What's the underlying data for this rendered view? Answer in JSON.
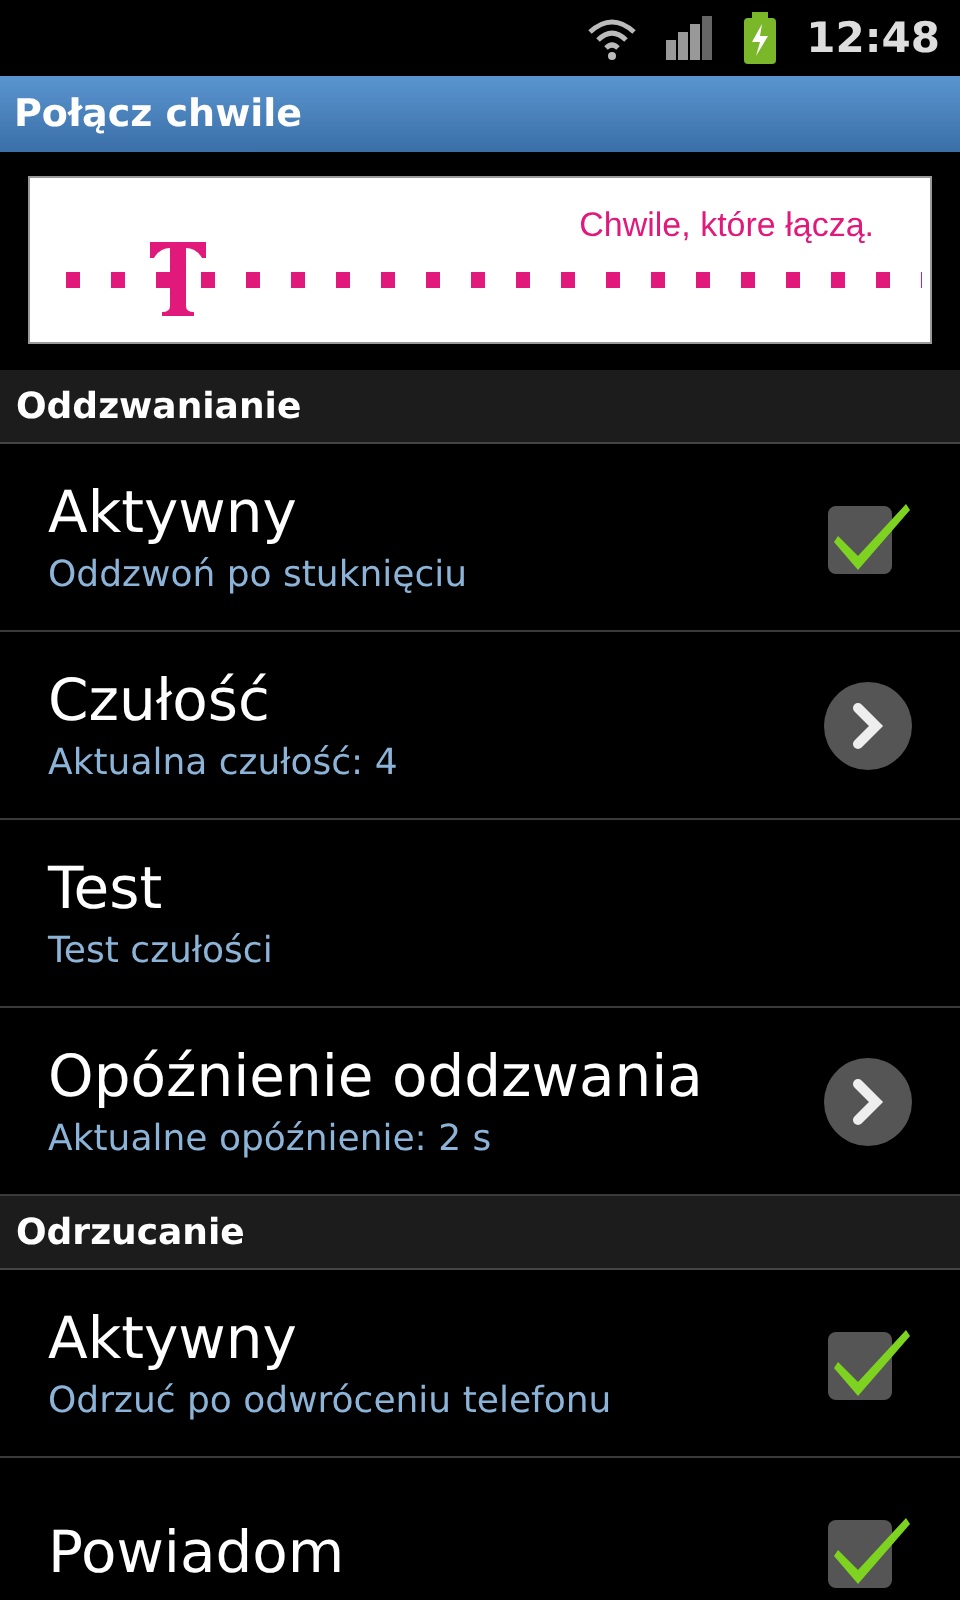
{
  "status_bar": {
    "time": "12:48"
  },
  "window": {
    "title": "Połącz chwile"
  },
  "banner": {
    "slogan": "Chwile, które łączą."
  },
  "sections": [
    {
      "title": "Oddzwanianie",
      "items": [
        {
          "kind": "checkbox",
          "title": "Aktywny",
          "summary": "Oddzwoń po stuknięciu",
          "checked": true
        },
        {
          "kind": "chevron",
          "title": "Czułość",
          "summary": "Aktualna czułość: 4"
        },
        {
          "kind": "plain",
          "title": "Test",
          "summary": "Test czułości"
        },
        {
          "kind": "chevron",
          "title": "Opóźnienie oddzwania",
          "summary": "Aktualne opóźnienie: 2 s"
        }
      ]
    },
    {
      "title": "Odrzucanie",
      "items": [
        {
          "kind": "checkbox",
          "title": "Aktywny",
          "summary": "Odrzuć po odwróceniu telefonu",
          "checked": true
        },
        {
          "kind": "checkbox",
          "title": "Powiadom",
          "checked": true
        }
      ]
    }
  ]
}
